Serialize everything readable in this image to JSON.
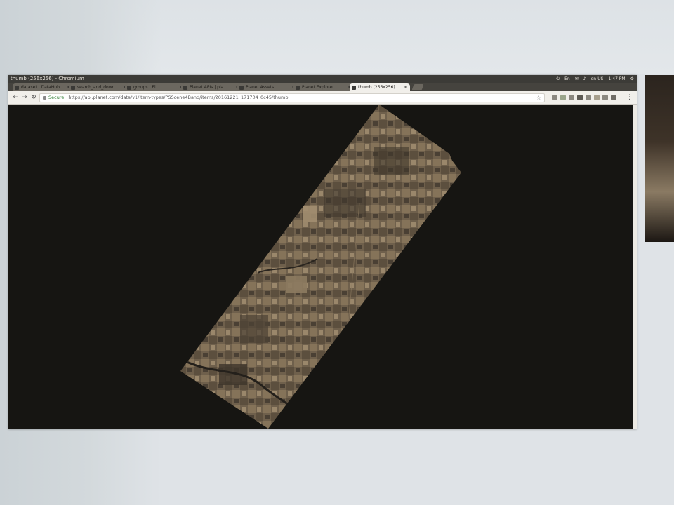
{
  "window": {
    "title": "thumb (256x256) - Chromium"
  },
  "systray": {
    "items": [
      "⏻",
      "En",
      "✉",
      "♪",
      "en-US",
      "1:47 PM",
      "⚙"
    ]
  },
  "tabs": [
    {
      "label": "dataset | DataHub",
      "active": false
    },
    {
      "label": "search_and_down",
      "active": false
    },
    {
      "label": "groups | Pl",
      "active": false
    },
    {
      "label": "Planet APIs | pla",
      "active": false
    },
    {
      "label": "Planet Assets",
      "active": false
    },
    {
      "label": "Planet Explorer",
      "active": false
    },
    {
      "label": "thumb (256x256)",
      "active": true
    }
  ],
  "toolbar": {
    "back_icon": "back-arrow-icon",
    "forward_icon": "forward-arrow-icon",
    "reload_icon": "reload-icon",
    "secure_label": "Secure",
    "url": "https://api.planet.com/data/v1/item-types/PSScene4Band/items/20161221_171704_0c45/thumb",
    "star_icon": "bookmark-star-icon",
    "menu_icon": "menu-dots-icon"
  },
  "viewport": {
    "background": "#161512",
    "image_description_icon": "satellite-strip-image"
  },
  "colors": {
    "titlebar": "#3c3b37",
    "tabstrip": "#45433e",
    "toolbar": "#f1efea",
    "image_tone": "#7a6a54"
  }
}
